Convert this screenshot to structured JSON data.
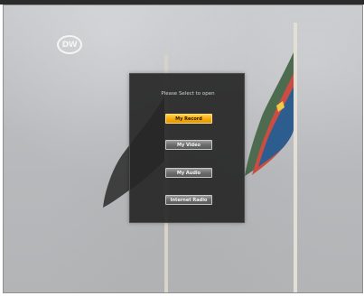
{
  "logo": {
    "text": "DW"
  },
  "menu": {
    "title": "Please Select to open",
    "items": [
      {
        "label": "My Record",
        "selected": true
      },
      {
        "label": "My Video",
        "selected": false
      },
      {
        "label": "My Audio",
        "selected": false
      },
      {
        "label": "Internet Radio",
        "selected": false
      }
    ]
  },
  "colors": {
    "selected_button": "#f4ab10",
    "panel": "#262626"
  }
}
